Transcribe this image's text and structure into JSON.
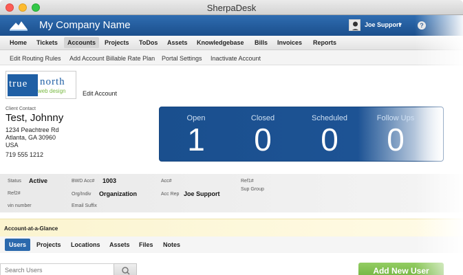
{
  "window": {
    "title": "SherpaDesk"
  },
  "header": {
    "company": "My Company Name",
    "user": "Joe Support",
    "help": "?"
  },
  "nav": {
    "items": [
      "Home",
      "Tickets",
      "Accounts",
      "Projects",
      "ToDos",
      "Assets",
      "Knowledgebase",
      "Bills",
      "Invoices",
      "Reports"
    ],
    "active": "Accounts"
  },
  "subnav": {
    "items": [
      "Edit Routing Rules",
      "Add Account Billable Rate Plan",
      "Portal Settings",
      "Inactivate Account"
    ]
  },
  "account": {
    "logo_text": [
      "true",
      "north",
      "web design"
    ],
    "edit_label": "Edit Account"
  },
  "contact": {
    "label": "Client Contact",
    "name": "Test, Johnny",
    "address1": "1234 Peachtree Rd",
    "address2": "Atlanta, GA 30960",
    "country": "USA",
    "phone": "719 555 1212"
  },
  "stats": [
    {
      "label": "Open",
      "value": "1"
    },
    {
      "label": "Closed",
      "value": "0"
    },
    {
      "label": "Scheduled",
      "value": "0"
    },
    {
      "label": "Follow Ups",
      "value": "0"
    }
  ],
  "details": {
    "status_label": "Status",
    "status_value": "Active",
    "bwd_label": "BWD Acc#",
    "bwd_value": "1003",
    "acc_label": "Acc#",
    "ref1_label": "Ref1#",
    "ref2_label": "Ref2#",
    "org_label": "Org/Indiv",
    "org_value": "Organization",
    "rep_label": "Acc Rep",
    "rep_value": "Joe Support",
    "sup_label": "Sup Group",
    "vin_label": "vin number",
    "email_label": "Email Suffix"
  },
  "glance": {
    "title": "Account-at-a-Glance"
  },
  "tabs": {
    "items": [
      "Users",
      "Projects",
      "Locations",
      "Assets",
      "Files",
      "Notes"
    ],
    "active": "Users"
  },
  "search": {
    "placeholder": "Search Users"
  },
  "actions": {
    "add_user": "Add New User"
  },
  "colors": {
    "brand_blue": "#1d5394",
    "accent_green": "#76b83f",
    "glance_yellow": "#fbf4cf"
  },
  "icons": {
    "logo": "mountain-logo-icon",
    "search": "search-icon",
    "help": "help-icon",
    "caret": "chevron-down-icon"
  }
}
